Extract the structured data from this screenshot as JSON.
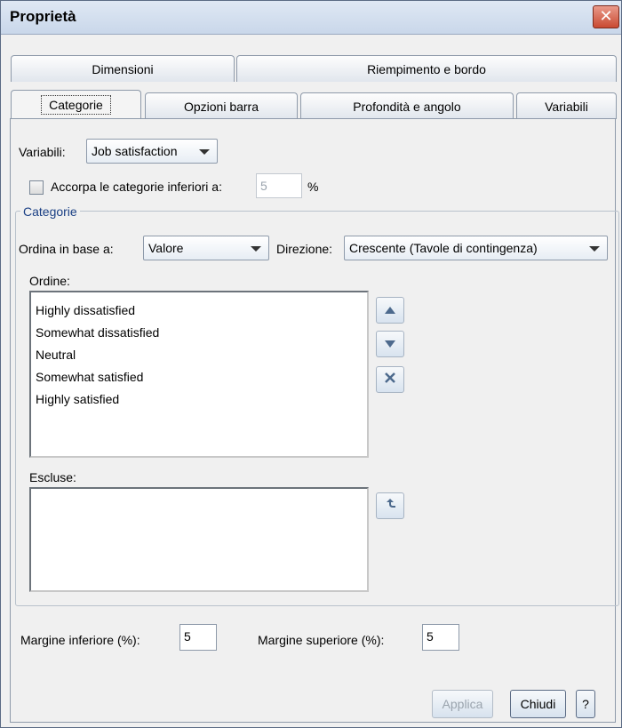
{
  "window": {
    "title": "Proprietà",
    "close_symbol": "✕"
  },
  "tabs_row1": [
    {
      "label": "Dimensioni"
    },
    {
      "label": "Riempimento e bordo"
    }
  ],
  "tabs_row2": [
    {
      "label": "Categorie",
      "active": true
    },
    {
      "label": "Opzioni barra"
    },
    {
      "label": "Profondità e angolo"
    },
    {
      "label": "Variabili"
    }
  ],
  "variables": {
    "label": "Variabili:",
    "value": "Job satisfaction"
  },
  "collapse": {
    "label": "Accorpa le categorie inferiori a:",
    "value": "5",
    "unit": "%",
    "checked": false
  },
  "categories_group": {
    "legend": "Categorie",
    "sort_label": "Ordina in base a:",
    "sort_value": "Valore",
    "direction_label": "Direzione:",
    "direction_value": "Crescente (Tavole di contingenza)",
    "order_label": "Ordine:",
    "order_items": [
      "Highly dissatisfied",
      "Somewhat dissatisfied",
      "Neutral",
      "Somewhat satisfied",
      "Highly satisfied"
    ],
    "excluded_label": "Escluse:"
  },
  "margins": {
    "lower_label": "Margine inferiore (%):",
    "lower_value": "5",
    "upper_label": "Margine superiore (%):",
    "upper_value": "5"
  },
  "buttons": {
    "apply": "Applica",
    "close": "Chiudi",
    "help": "?"
  },
  "icons": {
    "move_up": "triangle-up-icon",
    "move_down": "triangle-down-icon",
    "remove": "x-icon",
    "restore": "arrow-up-return-icon"
  }
}
